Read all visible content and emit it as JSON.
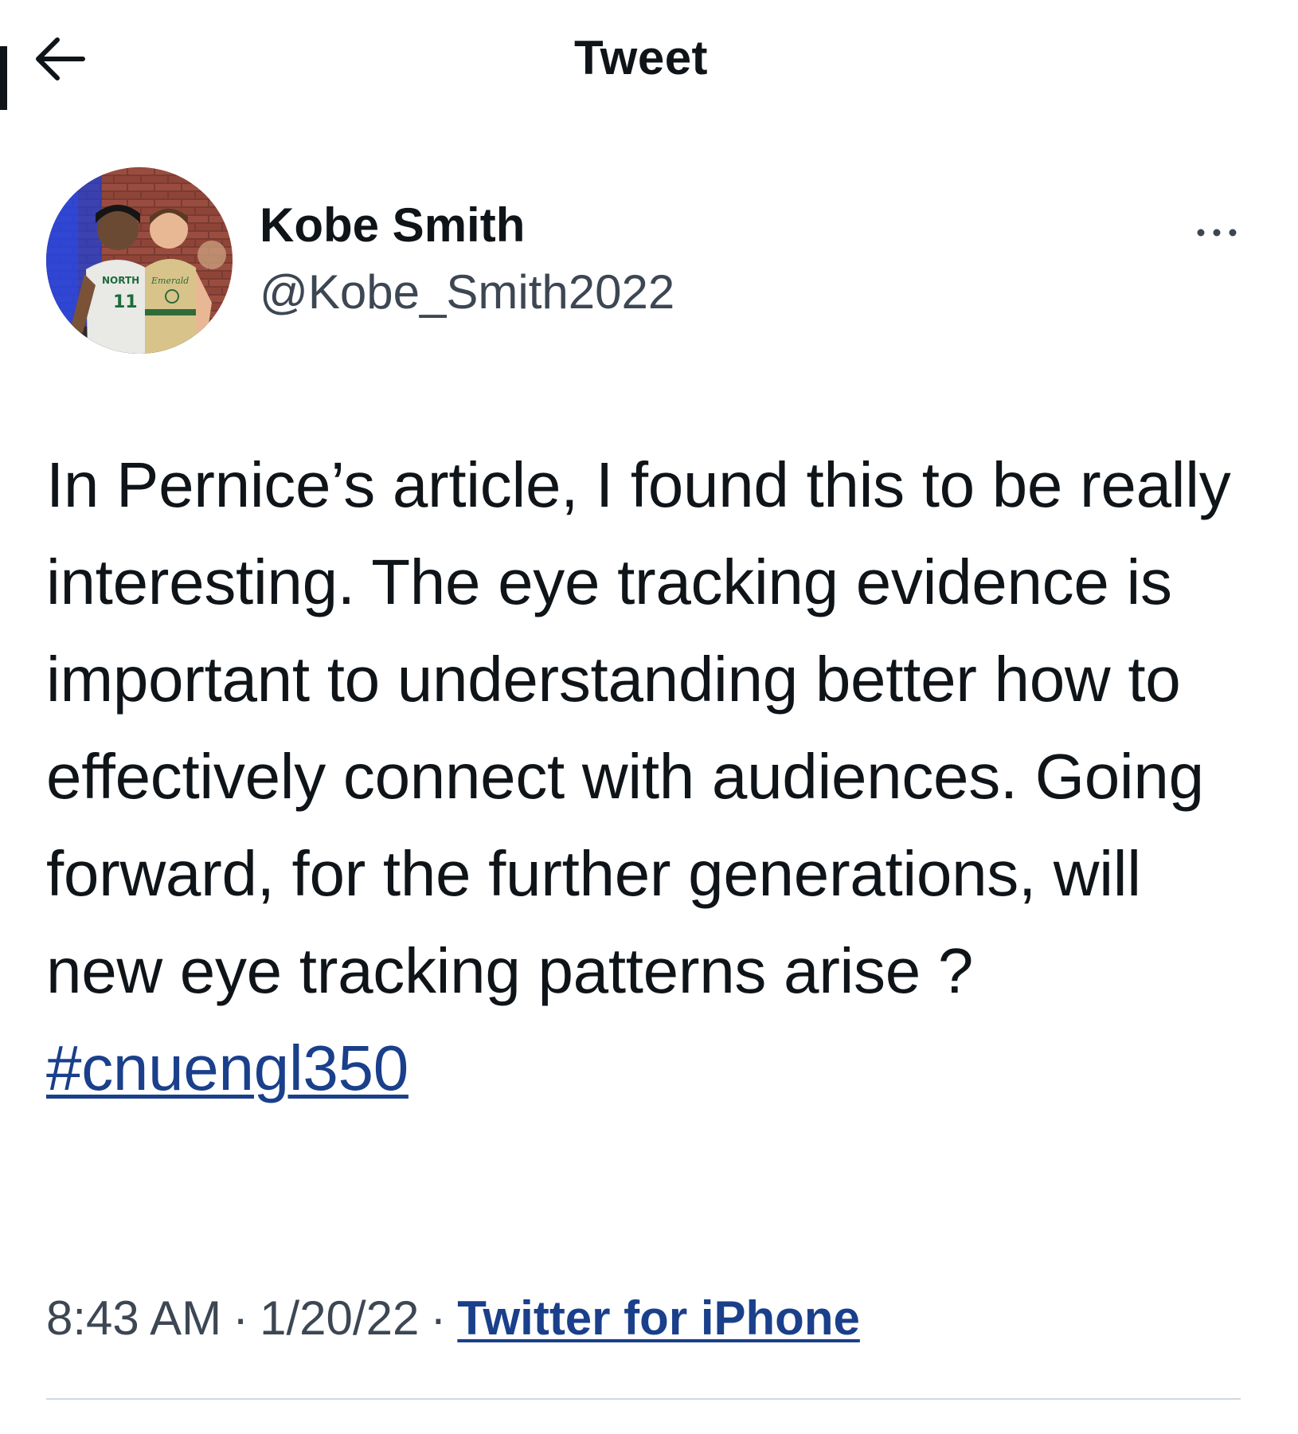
{
  "header": {
    "title": "Tweet",
    "back_icon": "arrow-left-icon"
  },
  "author": {
    "display_name": "Kobe Smith",
    "handle": "@Kobe_Smith2022",
    "more_icon": "ellipsis-icon"
  },
  "tweet": {
    "text": "In Pernice’s article, I found this to be really interesting. The eye tracking evidence is important to understanding better how to effectively connect with audiences. Going forward, for the further generations, will new eye tracking patterns arise ? ",
    "hashtag": "#cnuengl350"
  },
  "meta": {
    "time": "8:43 AM",
    "date": "1/20/22",
    "separator": "·",
    "source": "Twitter for iPhone"
  },
  "colors": {
    "text": "#0f1419",
    "secondary": "#3d4753",
    "link": "#1a3f8b",
    "divider": "#cfd9de"
  }
}
